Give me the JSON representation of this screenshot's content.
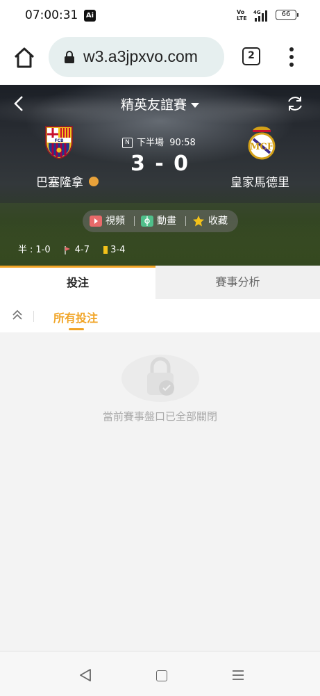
{
  "status_bar": {
    "time": "07:00:31",
    "notification_badge": "Ai",
    "volte": "Vo\nLTE",
    "network": "4G",
    "battery": "66"
  },
  "browser": {
    "url": "w3.a3jpxvo.com",
    "tab_count": "2"
  },
  "match": {
    "league": "精英友誼賽",
    "period_icon": "N",
    "period": "下半場",
    "clock": "90:58",
    "home_team": "巴塞隆拿",
    "away_team": "皇家馬德里",
    "score": "3 - 0",
    "actions": {
      "video": "視頻",
      "animation": "動畫",
      "favorite": "收藏"
    },
    "stats": {
      "half_label": "半",
      "half_score": "1-0",
      "corners": "4-7",
      "yellow_cards": "3-4"
    }
  },
  "tabs": {
    "bet": "投注",
    "analysis": "賽事分析"
  },
  "filter": {
    "all_bets": "所有投注"
  },
  "empty_state": {
    "message": "當前賽事盤口已全部關閉"
  },
  "colors": {
    "accent": "#f1a425",
    "yellow_card": "#f3c21a"
  }
}
